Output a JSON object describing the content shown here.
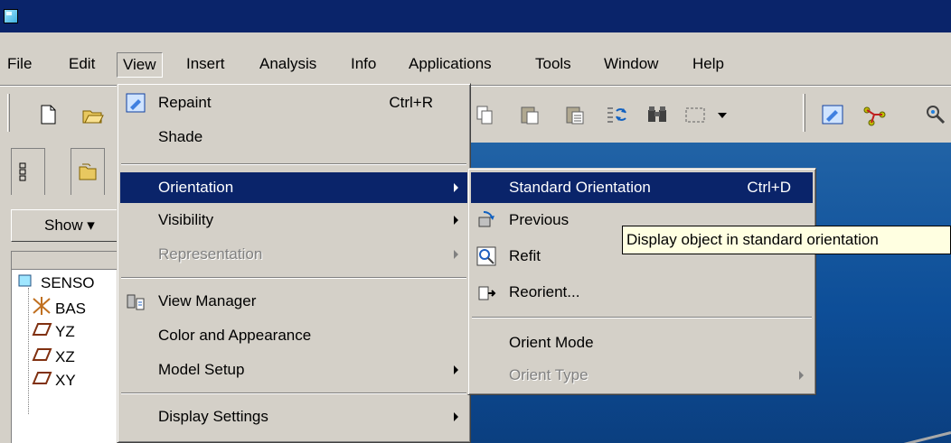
{
  "menubar": {
    "items": [
      {
        "label": "File"
      },
      {
        "label": "Edit"
      },
      {
        "label": "View"
      },
      {
        "label": "Insert"
      },
      {
        "label": "Analysis"
      },
      {
        "label": "Info"
      },
      {
        "label": "Applications"
      },
      {
        "label": "Tools"
      },
      {
        "label": "Window"
      },
      {
        "label": "Help"
      }
    ]
  },
  "left_panel": {
    "show_button": "Show ▾",
    "tree": [
      {
        "label": "SENSO",
        "icon": "part-icon"
      },
      {
        "label": "BAS",
        "icon": "coordinate-system-icon"
      },
      {
        "label": "YZ",
        "icon": "datum-plane-icon"
      },
      {
        "label": "XZ",
        "icon": "datum-plane-icon"
      },
      {
        "label": "XY",
        "icon": "datum-plane-icon"
      }
    ]
  },
  "view_menu": {
    "items": [
      {
        "label": "Repaint",
        "accel": "Ctrl+R",
        "icon": "repaint-icon"
      },
      {
        "label": "Shade"
      },
      {
        "label": "Orientation",
        "submenu": true,
        "highlighted": true
      },
      {
        "label": "Visibility",
        "submenu": true
      },
      {
        "label": "Representation",
        "submenu": true,
        "disabled": true
      },
      {
        "label": "View Manager",
        "icon": "view-manager-icon"
      },
      {
        "label": "Color and Appearance"
      },
      {
        "label": "Model Setup",
        "submenu": true
      },
      {
        "label": "Display Settings",
        "submenu": true
      }
    ]
  },
  "orientation_menu": {
    "items": [
      {
        "label": "Standard Orientation",
        "accel": "Ctrl+D",
        "highlighted": true
      },
      {
        "label": "Previous",
        "icon": "previous-view-icon"
      },
      {
        "label": "Refit",
        "icon": "refit-icon"
      },
      {
        "label": "Reorient...",
        "icon": "reorient-icon"
      },
      {
        "label": "Orient Mode"
      },
      {
        "label": "Orient Type",
        "submenu": true,
        "disabled": true
      }
    ]
  },
  "tooltip": {
    "text": "Display object in standard orientation"
  },
  "colors": {
    "titlebar": "#0a246a",
    "highlight": "#0a246a",
    "viewport": "#0d4e98",
    "chrome": "#d4d0c8",
    "tooltip": "#ffffe1"
  }
}
